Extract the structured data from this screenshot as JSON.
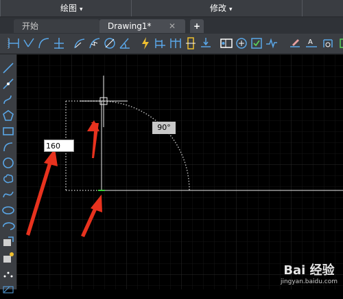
{
  "menubar": {
    "items": [
      {
        "label": "绘图",
        "caret": "▾"
      },
      {
        "label": "修改",
        "caret": "▾"
      }
    ]
  },
  "tabs": {
    "start_label": "开始",
    "drawing_label": "Drawing1*",
    "close_glyph": "✕",
    "new_glyph": "+"
  },
  "toolbar": {
    "icons": [
      "linear-dimension-icon",
      "aligned-dimension-icon",
      "arc-length-icon",
      "ordinate-dimension-icon",
      "radius-dimension-icon",
      "jogged-dimension-icon",
      "diameter-dimension-icon",
      "angular-dimension-icon",
      "quick-dimension-icon",
      "baseline-dimension-icon",
      "continue-dimension-icon",
      "dimension-space-icon",
      "dimension-break-icon",
      "tolerance-icon",
      "center-mark-icon",
      "inspection-icon",
      "jogged-linear-icon",
      "dimension-edit-icon",
      "dimension-text-edit-icon",
      "dimension-update-icon"
    ]
  },
  "left_tools": {
    "icons": [
      "line-icon",
      "construction-line-icon",
      "polyline-icon",
      "polygon-icon",
      "rectangle-icon",
      "arc-icon",
      "circle-icon",
      "revision-cloud-icon",
      "spline-icon",
      "ellipse-icon",
      "ellipse-arc-icon",
      "insert-block-icon",
      "make-block-icon",
      "point-icon",
      "hatch-icon"
    ]
  },
  "canvas": {
    "dynamic_input_value": "160",
    "angle_tooltip": "90°",
    "background": "#000000",
    "grid_color": "#1e1e1e",
    "arrow_color": "#e8321e"
  },
  "watermark": {
    "brand": "Bai 经验",
    "url": "jingyan.baidu.com"
  }
}
